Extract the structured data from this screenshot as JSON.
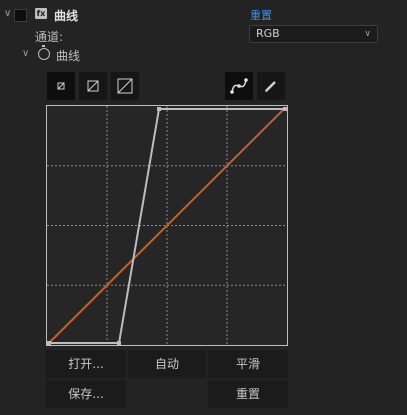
{
  "effect": {
    "title": "曲线",
    "badge": "fx",
    "reset_label": "重置"
  },
  "channel": {
    "label": "通道:",
    "value": "RGB"
  },
  "curve": {
    "label": "曲线"
  },
  "buttons": {
    "open": "打开...",
    "auto": "自动",
    "smooth": "平滑",
    "save": "保存...",
    "reset": "重置"
  },
  "colors": {
    "rgb_curve": "#c0622e",
    "active_curve": "#bdbdbd",
    "link": "#3d8eea"
  },
  "icons": {
    "grid_small": "grid-small-icon",
    "grid_medium": "grid-medium-icon",
    "grid_large": "grid-large-icon",
    "bezier_tool": "bezier-icon",
    "pencil_tool": "pencil-icon"
  }
}
